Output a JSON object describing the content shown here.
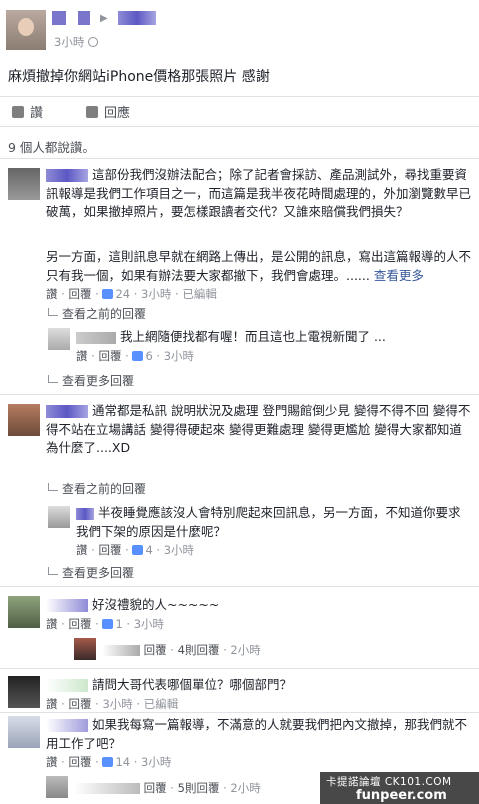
{
  "post": {
    "time": "3小時",
    "text": "麻煩撤掉你網站iPhone價格那張照片 感謝"
  },
  "actions": {
    "like": "讚",
    "comment": "回應"
  },
  "likes_summary": "9 個人都說讚。",
  "comments": [
    {
      "text": "這部份我們沒辦法配合；除了記者會採訪、產品測試外，尋找重要資訊報導是我們工作項目之一，而這篇是我半夜花時間處理的，外加瀏覽數早已破萬，如果撤掉照片，要怎樣跟讀者交代？又誰來賠償我們損失？",
      "text2": "另一方面，這則訊息早就在網路上傳出，是公開的訊息，寫出這篇報導的人不只有我一個，如果有辦法要大家都撤下，我們會處理。......",
      "see_more": "查看更多",
      "meta": {
        "like": "讚",
        "reply": "回覆",
        "likes": "24",
        "time": "3小時",
        "edited": "已編輯"
      },
      "prev_replies": "查看之前的回覆",
      "reply": {
        "text": "我上網隨便找都有喔！而且這也上電視新聞了 ...",
        "meta": {
          "like": "讚",
          "reply": "回覆",
          "likes": "6",
          "time": "3小時"
        }
      },
      "more_replies": "查看更多回覆"
    },
    {
      "text": "通常都是私訊 說明狀況及處理 登門賜館倒少見 變得不得不回 變得不得不站在立場講話 變得得硬起來 變得更難處理 變得更尷尬 變得大家都知道為什麼了....XD",
      "prev_replies": "查看之前的回覆",
      "reply": {
        "text": "半夜睡覺應該沒人會特別爬起來回訊息，另一方面，不知道你要求我們下架的原因是什麼呢？",
        "meta": {
          "like": "讚",
          "reply": "回覆",
          "likes": "4",
          "time": "3小時"
        }
      },
      "more_replies": "查看更多回覆"
    },
    {
      "text": "好沒禮貌的人~~~~~",
      "meta": {
        "like": "讚",
        "reply": "回覆",
        "likes": "1",
        "time": "3小時"
      },
      "reply_meta": {
        "reply": "回覆",
        "replies": "4則回覆",
        "time": "2小時"
      }
    },
    {
      "text": "請問大哥代表哪個單位？哪個部門？",
      "meta": {
        "like": "讚",
        "reply": "回覆",
        "time": "3小時",
        "edited": "已編輯"
      }
    },
    {
      "text": "如果我每寫一篇報導，不滿意的人就要我們把內文撤掉，那我們就不用工作了吧？",
      "meta": {
        "like": "讚",
        "reply": "回覆",
        "likes": "14",
        "time": "3小時"
      },
      "reply_meta": {
        "reply": "回覆",
        "replies": "5則回覆",
        "time": "2小時"
      }
    }
  ],
  "watermark": {
    "line1": "卡提諾論壇 CK101.COM",
    "line2": "funpeer.com"
  }
}
